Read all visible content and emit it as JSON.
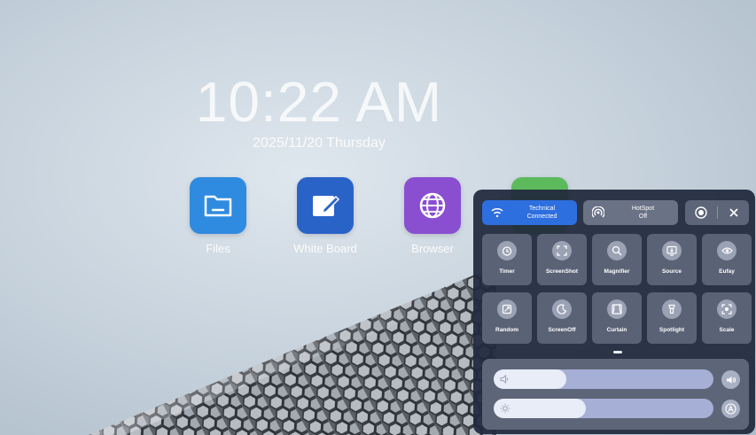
{
  "lockscreen": {
    "time": "10:22 AM",
    "date": "2025/11/20 Thursday"
  },
  "apps": [
    {
      "label": "Files",
      "icon": "folder-icon",
      "color": "#2f8be0"
    },
    {
      "label": "White Board",
      "icon": "pen-edit-icon",
      "color": "#2a63c8"
    },
    {
      "label": "Browser",
      "icon": "globe-icon",
      "color": "#8a4fd1"
    },
    {
      "label": "",
      "icon": "app-icon",
      "color": "#5cba5c"
    }
  ],
  "control_panel": {
    "wifi": {
      "line1": "Technical",
      "line2": "Connected",
      "icon": "wifi-icon",
      "color": "#2e6fe0"
    },
    "hotspot": {
      "line1": "HotSpot",
      "line2": "Off",
      "icon": "hotspot-icon"
    },
    "record_icon": "record-icon",
    "close_icon": "close-icon",
    "tiles": [
      {
        "label": "Timer",
        "icon": "timer-icon"
      },
      {
        "label": "ScreenShot",
        "icon": "screenshot-icon"
      },
      {
        "label": "Magnifier",
        "icon": "magnifier-icon"
      },
      {
        "label": "Source",
        "icon": "source-icon"
      },
      {
        "label": "Eufay",
        "icon": "eye-icon"
      },
      {
        "label": "Random",
        "icon": "random-icon"
      },
      {
        "label": "ScreenOff",
        "icon": "moon-icon"
      },
      {
        "label": "Curtain",
        "icon": "curtain-icon"
      },
      {
        "label": "Spotlight",
        "icon": "spotlight-icon"
      },
      {
        "label": "Scale",
        "icon": "scale-icon"
      }
    ],
    "volume": {
      "icon": "volume-icon",
      "level": 0.33,
      "button_icon": "speaker-icon"
    },
    "brightness": {
      "icon": "brightness-icon",
      "level": 0.42,
      "button_icon": "auto-brightness-icon"
    }
  }
}
